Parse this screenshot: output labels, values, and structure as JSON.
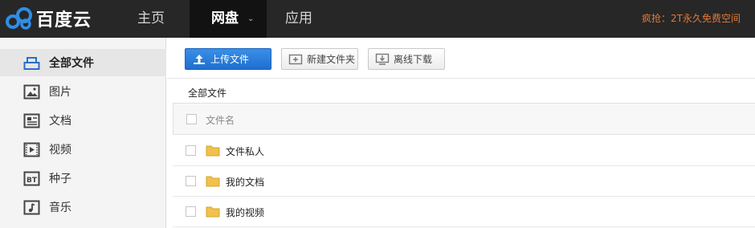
{
  "brand": {
    "name": "百度云",
    "logo_icon": "baidu-cloud-logo-icon"
  },
  "nav": {
    "home": "主页",
    "disk": "网盘",
    "apps": "应用",
    "promo": "疯抢：2T永久免费空间"
  },
  "sidebar": {
    "items": [
      {
        "label": "全部文件",
        "icon": "all-files-icon",
        "active": true
      },
      {
        "label": "图片",
        "icon": "image-icon"
      },
      {
        "label": "文档",
        "icon": "document-icon"
      },
      {
        "label": "视频",
        "icon": "video-icon"
      },
      {
        "label": "种子",
        "icon": "bt-torrent-icon"
      },
      {
        "label": "音乐",
        "icon": "music-icon"
      }
    ]
  },
  "toolbar": {
    "upload_label": "上传文件",
    "new_folder_label": "新建文件夹",
    "offline_label": "离线下载"
  },
  "breadcrumb": "全部文件",
  "list": {
    "header_filename": "文件名",
    "rows": [
      {
        "name": "文件私人"
      },
      {
        "name": "我的文档"
      },
      {
        "name": "我的视频"
      }
    ]
  },
  "colors": {
    "accent": "#2a7fdc",
    "topbar": "#272727",
    "promo": "#e2783a",
    "folder": "#f0c14b"
  }
}
